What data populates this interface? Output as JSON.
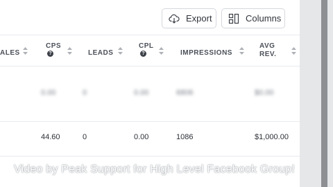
{
  "toolbar": {
    "export_label": "Export",
    "columns_label": "Columns"
  },
  "table": {
    "columns": [
      {
        "label": "ALES",
        "sub": ""
      },
      {
        "label": "CPS",
        "sub": "?"
      },
      {
        "label": "LEADS",
        "sub": ""
      },
      {
        "label": "CPL",
        "sub": "?"
      },
      {
        "label": "IMPRESSIONS",
        "sub": ""
      },
      {
        "label": "AVG",
        "sub": "REV."
      }
    ],
    "rows": [
      {
        "cps": "0.00",
        "leads": "0",
        "cpl": "0.00",
        "impressions": "6806",
        "avg_rev": "$0.00"
      },
      {
        "cps": "44.60",
        "leads": "0",
        "cpl": "0.00",
        "impressions": "1086",
        "avg_rev": "$1,000.00"
      }
    ]
  },
  "watermark": "Video by Peak Support for High Level Facebook Group!"
}
